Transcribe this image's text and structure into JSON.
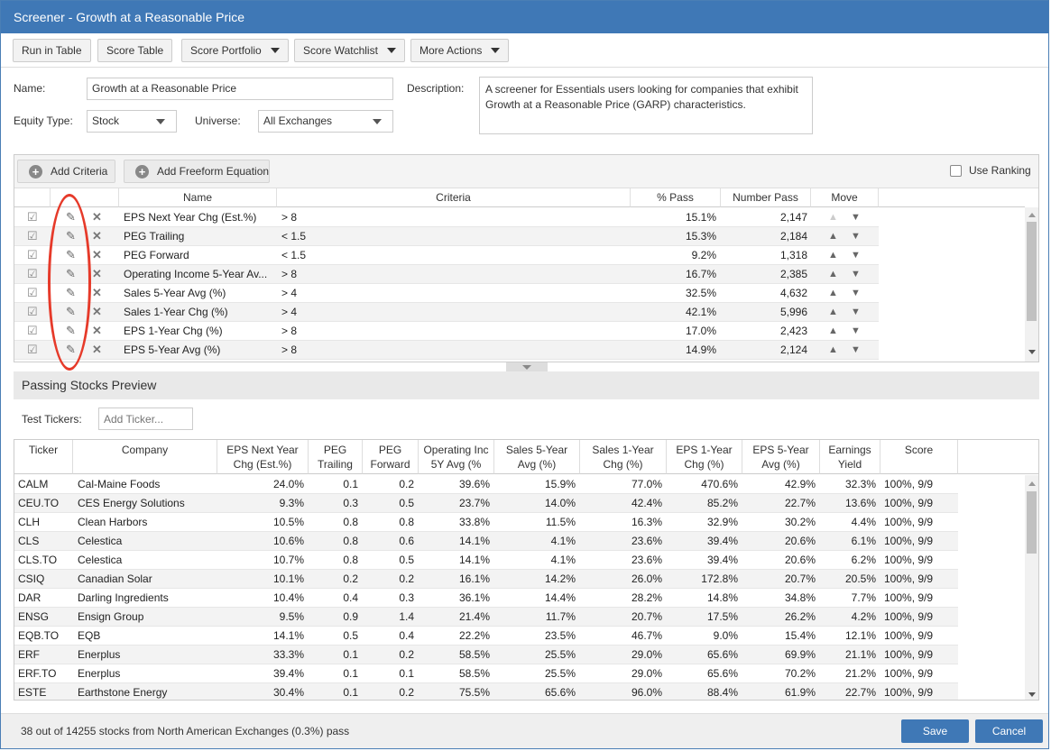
{
  "window": {
    "title": "Screener - Growth at a Reasonable Price"
  },
  "toolbar": {
    "run_in_table": "Run in Table",
    "score_table": "Score Table",
    "score_portfolio": "Score Portfolio",
    "score_watchlist": "Score Watchlist",
    "more_actions": "More Actions"
  },
  "form": {
    "name_label": "Name:",
    "name_value": "Growth at a Reasonable Price",
    "equity_type_label": "Equity Type:",
    "equity_type_value": "Stock",
    "universe_label": "Universe:",
    "universe_value": "All Exchanges",
    "description_label": "Description:",
    "description_value": "A screener for Essentials users looking for companies that exhibit Growth at a Reasonable Price (GARP) characteristics."
  },
  "criteria_panel": {
    "add_criteria": "Add Criteria",
    "add_freeform": "Add Freeform Equation",
    "use_ranking": "Use Ranking",
    "columns": {
      "name": "Name",
      "criteria": "Criteria",
      "pct_pass": "% Pass",
      "number_pass": "Number Pass",
      "move": "Move"
    },
    "rows": [
      {
        "name": "EPS Next Year Chg (Est.%)",
        "criteria": "> 8",
        "pct_pass": "15.1%",
        "number_pass": "2,147"
      },
      {
        "name": "PEG Trailing",
        "criteria": "< 1.5",
        "pct_pass": "15.3%",
        "number_pass": "2,184"
      },
      {
        "name": "PEG Forward",
        "criteria": "< 1.5",
        "pct_pass": "9.2%",
        "number_pass": "1,318"
      },
      {
        "name": "Operating Income 5-Year Av...",
        "criteria": "> 8",
        "pct_pass": "16.7%",
        "number_pass": "2,385"
      },
      {
        "name": "Sales 5-Year Avg (%)",
        "criteria": "> 4",
        "pct_pass": "32.5%",
        "number_pass": "4,632"
      },
      {
        "name": "Sales 1-Year Chg (%)",
        "criteria": "> 4",
        "pct_pass": "42.1%",
        "number_pass": "5,996"
      },
      {
        "name": "EPS 1-Year Chg (%)",
        "criteria": "> 8",
        "pct_pass": "17.0%",
        "number_pass": "2,423"
      },
      {
        "name": "EPS 5-Year Avg (%)",
        "criteria": "> 8",
        "pct_pass": "14.9%",
        "number_pass": "2,124"
      }
    ]
  },
  "preview": {
    "title": "Passing Stocks Preview",
    "test_tickers_label": "Test Tickers:",
    "test_tickers_placeholder": "Add Ticker...",
    "columns": {
      "ticker": "Ticker",
      "company": "Company",
      "eps_next_l1": "EPS Next Year",
      "eps_next_l2": "Chg (Est.%)",
      "peg_t_l1": "PEG",
      "peg_t_l2": "Trailing",
      "peg_f_l1": "PEG",
      "peg_f_l2": "Forward",
      "opinc_l1": "Operating Inc",
      "opinc_l2": "5Y Avg (%",
      "sales5_l1": "Sales 5-Year",
      "sales5_l2": "Avg (%)",
      "sales1_l1": "Sales 1-Year",
      "sales1_l2": "Chg (%)",
      "eps1_l1": "EPS 1-Year",
      "eps1_l2": "Chg (%)",
      "eps5_l1": "EPS 5-Year",
      "eps5_l2": "Avg (%)",
      "ey_l1": "Earnings",
      "ey_l2": "Yield",
      "score": "Score"
    },
    "rows": [
      {
        "ticker": "CALM",
        "company": "Cal-Maine Foods",
        "eps_next": "24.0%",
        "peg_t": "0.1",
        "peg_f": "0.2",
        "opinc": "39.6%",
        "sales5": "15.9%",
        "sales1": "77.0%",
        "eps1": "470.6%",
        "eps5": "42.9%",
        "ey": "32.3%",
        "score": "100%, 9/9"
      },
      {
        "ticker": "CEU.TO",
        "company": "CES Energy Solutions",
        "eps_next": "9.3%",
        "peg_t": "0.3",
        "peg_f": "0.5",
        "opinc": "23.7%",
        "sales5": "14.0%",
        "sales1": "42.4%",
        "eps1": "85.2%",
        "eps5": "22.7%",
        "ey": "13.6%",
        "score": "100%, 9/9"
      },
      {
        "ticker": "CLH",
        "company": "Clean Harbors",
        "eps_next": "10.5%",
        "peg_t": "0.8",
        "peg_f": "0.8",
        "opinc": "33.8%",
        "sales5": "11.5%",
        "sales1": "16.3%",
        "eps1": "32.9%",
        "eps5": "30.2%",
        "ey": "4.4%",
        "score": "100%, 9/9"
      },
      {
        "ticker": "CLS",
        "company": "Celestica",
        "eps_next": "10.6%",
        "peg_t": "0.8",
        "peg_f": "0.6",
        "opinc": "14.1%",
        "sales5": "4.1%",
        "sales1": "23.6%",
        "eps1": "39.4%",
        "eps5": "20.6%",
        "ey": "6.1%",
        "score": "100%, 9/9"
      },
      {
        "ticker": "CLS.TO",
        "company": "Celestica",
        "eps_next": "10.7%",
        "peg_t": "0.8",
        "peg_f": "0.5",
        "opinc": "14.1%",
        "sales5": "4.1%",
        "sales1": "23.6%",
        "eps1": "39.4%",
        "eps5": "20.6%",
        "ey": "6.2%",
        "score": "100%, 9/9"
      },
      {
        "ticker": "CSIQ",
        "company": "Canadian Solar",
        "eps_next": "10.1%",
        "peg_t": "0.2",
        "peg_f": "0.2",
        "opinc": "16.1%",
        "sales5": "14.2%",
        "sales1": "26.0%",
        "eps1": "172.8%",
        "eps5": "20.7%",
        "ey": "20.5%",
        "score": "100%, 9/9"
      },
      {
        "ticker": "DAR",
        "company": "Darling Ingredients",
        "eps_next": "10.4%",
        "peg_t": "0.4",
        "peg_f": "0.3",
        "opinc": "36.1%",
        "sales5": "14.4%",
        "sales1": "28.2%",
        "eps1": "14.8%",
        "eps5": "34.8%",
        "ey": "7.7%",
        "score": "100%, 9/9"
      },
      {
        "ticker": "ENSG",
        "company": "Ensign Group",
        "eps_next": "9.5%",
        "peg_t": "0.9",
        "peg_f": "1.4",
        "opinc": "21.4%",
        "sales5": "11.7%",
        "sales1": "20.7%",
        "eps1": "17.5%",
        "eps5": "26.2%",
        "ey": "4.2%",
        "score": "100%, 9/9"
      },
      {
        "ticker": "EQB.TO",
        "company": "EQB",
        "eps_next": "14.1%",
        "peg_t": "0.5",
        "peg_f": "0.4",
        "opinc": "22.2%",
        "sales5": "23.5%",
        "sales1": "46.7%",
        "eps1": "9.0%",
        "eps5": "15.4%",
        "ey": "12.1%",
        "score": "100%, 9/9"
      },
      {
        "ticker": "ERF",
        "company": "Enerplus",
        "eps_next": "33.3%",
        "peg_t": "0.1",
        "peg_f": "0.2",
        "opinc": "58.5%",
        "sales5": "25.5%",
        "sales1": "29.0%",
        "eps1": "65.6%",
        "eps5": "69.9%",
        "ey": "21.1%",
        "score": "100%, 9/9"
      },
      {
        "ticker": "ERF.TO",
        "company": "Enerplus",
        "eps_next": "39.4%",
        "peg_t": "0.1",
        "peg_f": "0.1",
        "opinc": "58.5%",
        "sales5": "25.5%",
        "sales1": "29.0%",
        "eps1": "65.6%",
        "eps5": "70.2%",
        "ey": "21.2%",
        "score": "100%, 9/9"
      },
      {
        "ticker": "ESTE",
        "company": "Earthstone Energy",
        "eps_next": "30.4%",
        "peg_t": "0.1",
        "peg_f": "0.2",
        "opinc": "75.5%",
        "sales5": "65.6%",
        "sales1": "96.0%",
        "eps1": "88.4%",
        "eps5": "61.9%",
        "ey": "22.7%",
        "score": "100%, 9/9"
      }
    ]
  },
  "footer": {
    "status": "38 out of 14255 stocks from North American Exchanges (0.3%) pass",
    "save": "Save",
    "cancel": "Cancel"
  },
  "colors": {
    "accent": "#3f78b6",
    "annotation": "#e63a2a"
  },
  "icons": [
    "checkmark-icon",
    "edit-icon",
    "delete-icon",
    "move-up-icon",
    "move-down-icon",
    "plus-circle-icon",
    "dropdown-caret-icon"
  ]
}
